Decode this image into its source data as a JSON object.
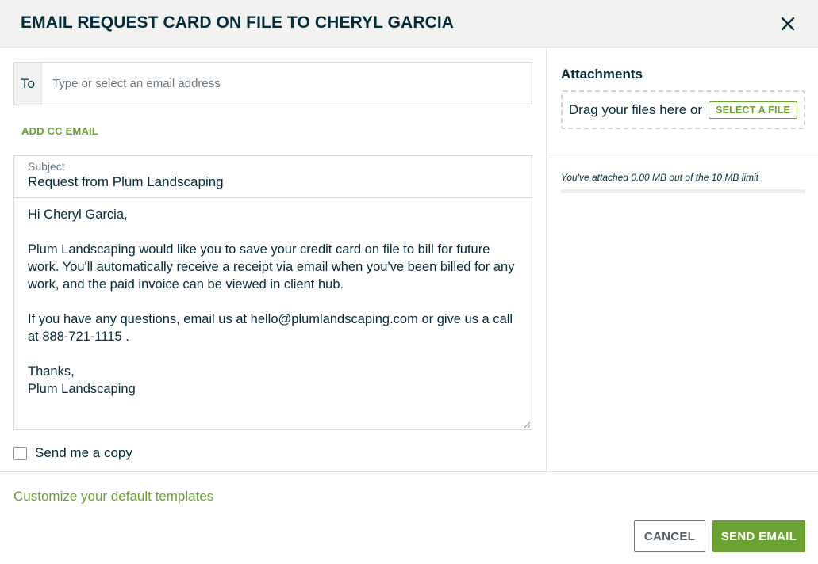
{
  "dialog": {
    "title": "EMAIL REQUEST CARD ON FILE TO CHERYL GARCIA",
    "close_icon": "close-icon"
  },
  "to": {
    "label": "To",
    "placeholder": "Type or select an email address",
    "value": ""
  },
  "add_cc_label": "ADD CC EMAIL",
  "subject": {
    "label": "Subject",
    "value": "Request from Plum Landscaping"
  },
  "message": {
    "greeting": "Hi Cheryl Garcia,",
    "paragraph1": "Plum Landscaping would like you to save your credit card on file to bill for future work. You'll automatically receive a receipt via email when you've been billed for any work, and the paid invoice can be viewed in client hub.",
    "paragraph2": "If you have any questions, email us at hello@plumlandscaping.com or give us a call at 888-721-1115 .",
    "signoff": "Thanks,",
    "signature": "Plum Landscaping"
  },
  "send_copy": {
    "label": "Send me a copy",
    "checked": false
  },
  "attachments": {
    "title": "Attachments",
    "drop_text": "Drag your files here or",
    "select_label": "SELECT A FILE",
    "limit_text": "You've attached 0.00 MB out of the 10 MB limit",
    "used_fraction": 0
  },
  "footer": {
    "customize_link": "Customize your default templates",
    "cancel_label": "CANCEL",
    "send_label": "SEND EMAIL"
  },
  "colors": {
    "accent": "#6aa232",
    "text": "#032b3a",
    "header_bg": "#f2f2f0"
  }
}
